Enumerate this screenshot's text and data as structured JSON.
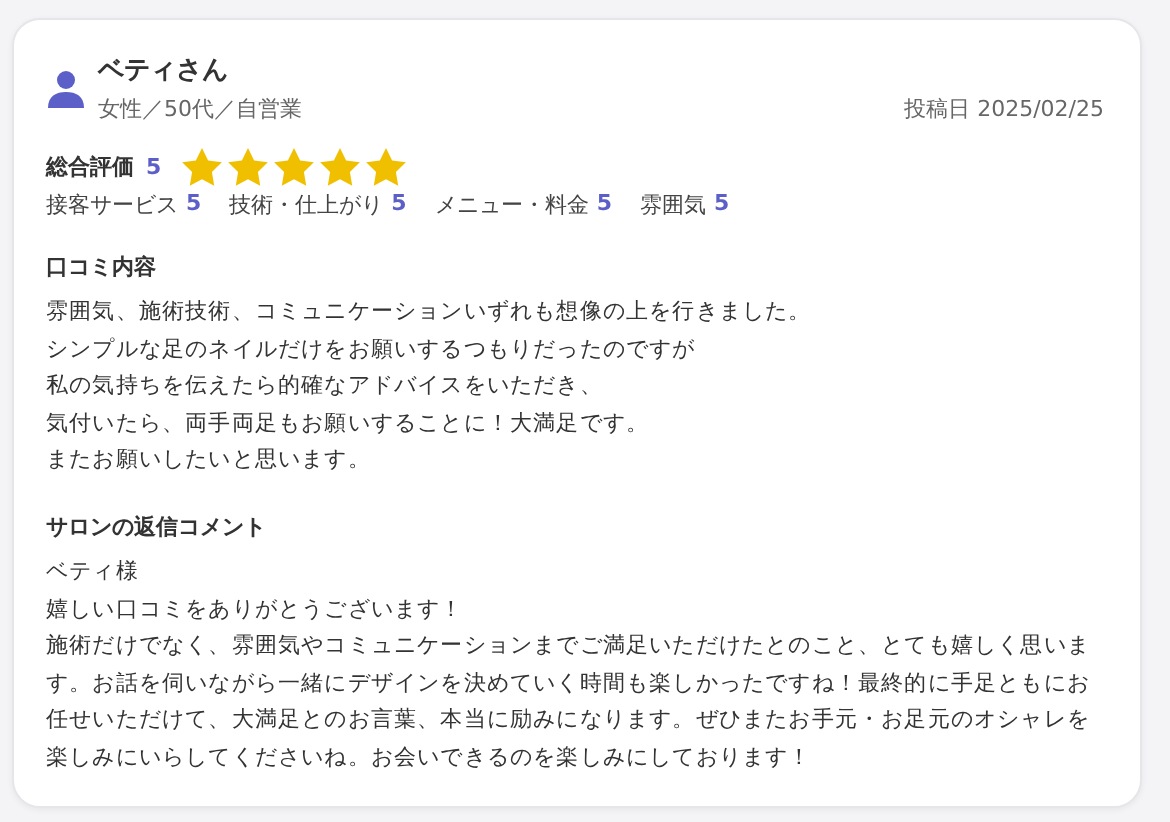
{
  "reviewer": {
    "name": "ベティさん",
    "profile": "女性／50代／自営業"
  },
  "posted": "投稿日 2025/02/25",
  "overall": {
    "label": "総合評価",
    "score": "5",
    "stars": 5
  },
  "ratings": [
    {
      "label": "接客サービス",
      "score": "5"
    },
    {
      "label": "技術・仕上がり",
      "score": "5"
    },
    {
      "label": "メニュー・料金",
      "score": "5"
    },
    {
      "label": "雰囲気",
      "score": "5"
    }
  ],
  "review": {
    "heading": "口コミ内容",
    "lines": [
      "雰囲気、施術技術、コミュニケーションいずれも想像の上を行きました。",
      "シンプルな足のネイルだけをお願いするつもりだったのですが",
      "私の気持ちを伝えたら的確なアドバイスをいただき、",
      "気付いたら、両手両足もお願いすることに！大満足です。",
      "またお願いしたいと思います。"
    ]
  },
  "reply": {
    "heading": "サロンの返信コメント",
    "lines": [
      "ベティ様",
      "嬉しい口コミをありがとうございます！",
      "施術だけでなく、雰囲気やコミュニケーションまでご満足いただけたとのこと、とても嬉しく思います。お話を伺いながら一緒にデザインを決めていく時間も楽しかったですね！最終的に手足ともにお任せいただけて、大満足とのお言葉、本当に励みになります。ぜひまたお手元・お足元のオシャレを楽しみにいらしてくださいね。お会いできるのを楽しみにしております！"
    ]
  }
}
